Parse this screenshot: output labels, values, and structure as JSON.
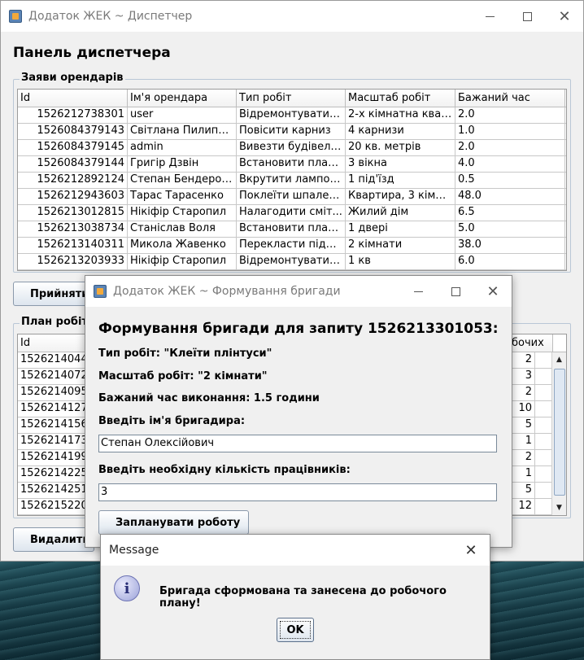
{
  "main_window": {
    "title": "Додаток ЖЕК ~ Диспетчер",
    "panel_title": "Панель диспетчера",
    "requests_group": "Заяви орендарів",
    "columns": [
      "Id",
      "Ім'я орендара",
      "Тип робіт",
      "Масштаб робіт",
      "Бажаний час"
    ],
    "rows": [
      [
        "1526212738301",
        "user",
        "Відремонтувати р...",
        "2-х кімнатна квар...",
        "2.0"
      ],
      [
        "1526084379143",
        "Світлана Пилипен...",
        "Повісити карниз",
        "4 карнизи",
        "1.0"
      ],
      [
        "1526084379145",
        "admin",
        "Вивезти будівель...",
        "20 кв. метрів",
        "2.0"
      ],
      [
        "1526084379144",
        "Григір Дзвін",
        "Встановити пласт...",
        "3 вікна",
        "4.0"
      ],
      [
        "1526212892124",
        "Степан Бендеров...",
        "Вкрутити лампоч...",
        "1 під'їзд",
        "0.5"
      ],
      [
        "1526212943603",
        "Тарас Тарасенко",
        "Поклеїти шпалери",
        "Квартира, 3 кімна...",
        "48.0"
      ],
      [
        "1526213012815",
        "Нікіфір Старопил",
        "Налагодити сміт...",
        "Жилий дім",
        "6.5"
      ],
      [
        "1526213038734",
        "Станіслав Воля",
        "Встановити пласт...",
        "1 двері",
        "5.0"
      ],
      [
        "1526213140311",
        "Микола Жавенко",
        "Перекласти підло...",
        "2 кімнати",
        "38.0"
      ],
      [
        "1526213203933",
        "Нікіфір Старопил",
        "Відремонтувати с...",
        "1 кв",
        "6.0"
      ]
    ],
    "accept_button": "Прийняти",
    "plan_group": "План робіт",
    "plan_columns": [
      "Id",
      "бочих"
    ],
    "plan_rows": [
      [
        "1526214044",
        "2"
      ],
      [
        "1526214072",
        "3"
      ],
      [
        "1526214095",
        "2"
      ],
      [
        "1526214127",
        "10"
      ],
      [
        "1526214156",
        "5"
      ],
      [
        "1526214173",
        "1"
      ],
      [
        "1526214199",
        "2"
      ],
      [
        "1526214225",
        "1"
      ],
      [
        "1526214251",
        "5"
      ],
      [
        "1526215220",
        "12"
      ]
    ],
    "delete_button": "Видалити"
  },
  "team_dialog": {
    "title": "Додаток ЖЕК ~ Формування бригади",
    "heading": "Формування бригади для запиту 1526213301053:",
    "work_type": "Тип робіт: \"Клеїти плінтуси\"",
    "work_scale": "Масштаб робіт: \"2 кімнати\"",
    "desired_time": "Бажаний час виконання: 1.5 години",
    "foreman_label": "Введіть ім'я бригадира:",
    "foreman_value": "Степан Олексійович",
    "workers_label": "Введіть необхідну кількість працівників:",
    "workers_value": "3",
    "schedule_button": "Запланувати роботу"
  },
  "message_box": {
    "title": "Message",
    "text": "Бригада сформована та занесена до робочого плану!",
    "ok_button": "OK"
  }
}
